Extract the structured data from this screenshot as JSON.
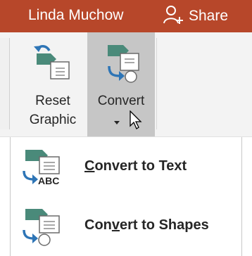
{
  "titlebar": {
    "user_name": "Linda Muchow",
    "share_label": "Share",
    "accent_color": "#b7472a"
  },
  "ribbon": {
    "reset": {
      "line1": "Reset",
      "line2": "Graphic"
    },
    "convert": {
      "line1": "Convert",
      "state": "pressed"
    }
  },
  "menu": {
    "items": [
      {
        "label_pre": "",
        "label_key": "C",
        "label_post": "onvert to Text",
        "icon": "convert-to-text-icon"
      },
      {
        "label_pre": "Con",
        "label_key": "v",
        "label_post": "ert to Shapes",
        "icon": "convert-to-shapes-icon"
      }
    ]
  }
}
